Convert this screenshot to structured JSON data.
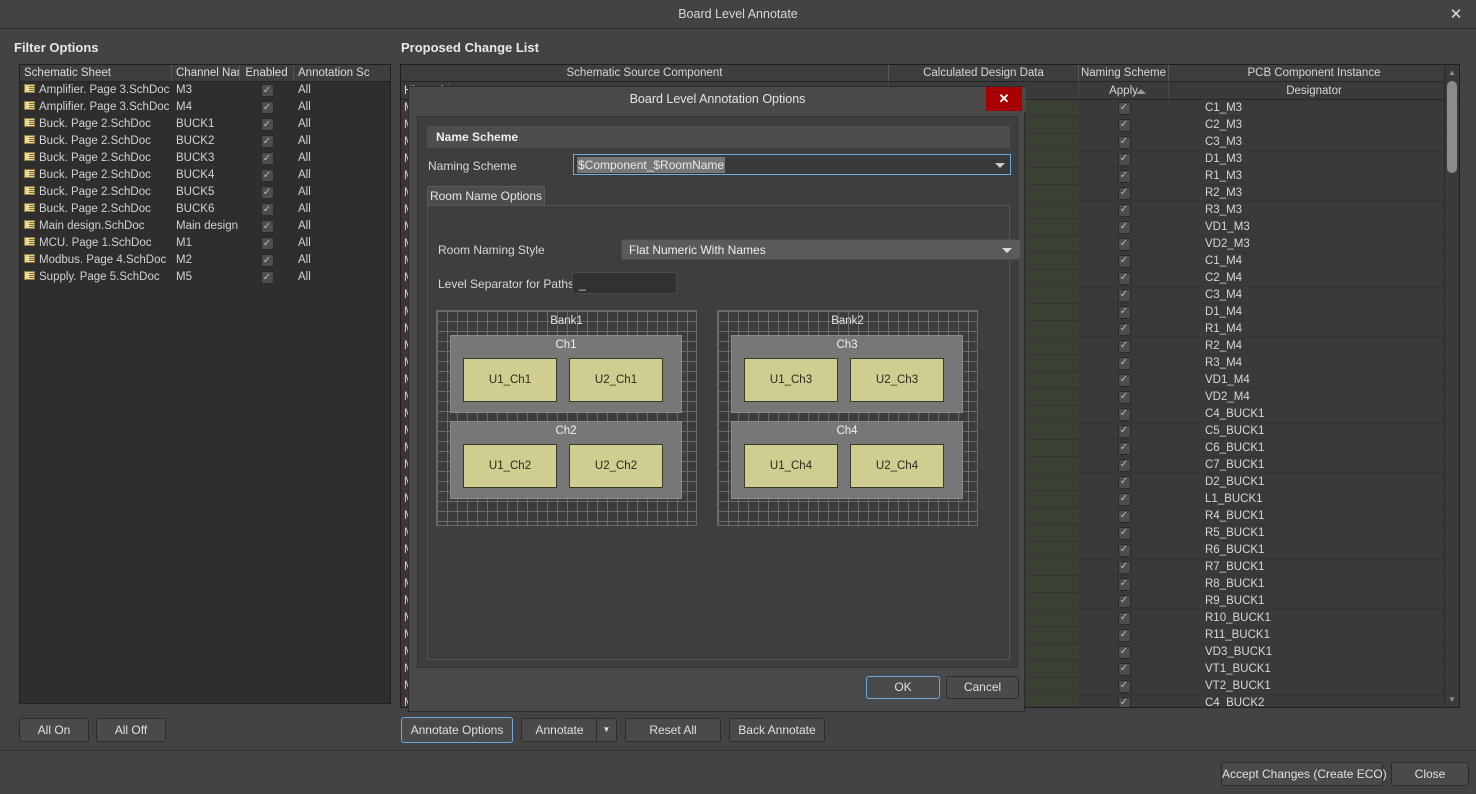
{
  "window": {
    "title": "Board Level Annotate",
    "close_icon": "close-icon"
  },
  "filter": {
    "label": "Filter Options",
    "columns": [
      "Schematic Sheet",
      "Channel Name",
      "Enabled",
      "Annotation Sc"
    ],
    "rows": [
      {
        "sheet": "Amplifier. Page 3.SchDoc",
        "channel": "M3",
        "enabled": true,
        "scope": "All"
      },
      {
        "sheet": "Amplifier. Page 3.SchDoc",
        "channel": "M4",
        "enabled": true,
        "scope": "All"
      },
      {
        "sheet": "Buck. Page 2.SchDoc",
        "channel": "BUCK1",
        "enabled": true,
        "scope": "All"
      },
      {
        "sheet": "Buck. Page 2.SchDoc",
        "channel": "BUCK2",
        "enabled": true,
        "scope": "All"
      },
      {
        "sheet": "Buck. Page 2.SchDoc",
        "channel": "BUCK3",
        "enabled": true,
        "scope": "All"
      },
      {
        "sheet": "Buck. Page 2.SchDoc",
        "channel": "BUCK4",
        "enabled": true,
        "scope": "All"
      },
      {
        "sheet": "Buck. Page 2.SchDoc",
        "channel": "BUCK5",
        "enabled": true,
        "scope": "All"
      },
      {
        "sheet": "Buck. Page 2.SchDoc",
        "channel": "BUCK6",
        "enabled": true,
        "scope": "All"
      },
      {
        "sheet": "Main design.SchDoc",
        "channel": "Main design",
        "enabled": true,
        "scope": "All"
      },
      {
        "sheet": "MCU. Page 1.SchDoc",
        "channel": "M1",
        "enabled": true,
        "scope": "All"
      },
      {
        "sheet": "Modbus. Page 4.SchDoc",
        "channel": "M2",
        "enabled": true,
        "scope": "All"
      },
      {
        "sheet": "Supply. Page 5.SchDoc",
        "channel": "M5",
        "enabled": true,
        "scope": "All"
      }
    ],
    "all_on_label": "All On",
    "all_off_label": "All Off"
  },
  "change_list": {
    "label": "Proposed Change List",
    "group_headers": [
      "Schematic Source Component",
      "Calculated Design Data",
      "Naming Scheme",
      "PCB Component Instance"
    ],
    "col_headers": {
      "hierarchy": "Hierarch",
      "apply": "Apply",
      "designator": "Designator"
    },
    "hierarchy_cell": "Main de",
    "rows": [
      {
        "designator": "C1_M3",
        "apply": true
      },
      {
        "designator": "C2_M3",
        "apply": true
      },
      {
        "designator": "C3_M3",
        "apply": true
      },
      {
        "designator": "D1_M3",
        "apply": true
      },
      {
        "designator": "R1_M3",
        "apply": true
      },
      {
        "designator": "R2_M3",
        "apply": true
      },
      {
        "designator": "R3_M3",
        "apply": true
      },
      {
        "designator": "VD1_M3",
        "apply": true
      },
      {
        "designator": "VD2_M3",
        "apply": true
      },
      {
        "designator": "C1_M4",
        "apply": true
      },
      {
        "designator": "C2_M4",
        "apply": true
      },
      {
        "designator": "C3_M4",
        "apply": true
      },
      {
        "designator": "D1_M4",
        "apply": true
      },
      {
        "designator": "R1_M4",
        "apply": true
      },
      {
        "designator": "R2_M4",
        "apply": true
      },
      {
        "designator": "R3_M4",
        "apply": true
      },
      {
        "designator": "VD1_M4",
        "apply": true
      },
      {
        "designator": "VD2_M4",
        "apply": true
      },
      {
        "designator": "C4_BUCK1",
        "apply": true
      },
      {
        "designator": "C5_BUCK1",
        "apply": true
      },
      {
        "designator": "C6_BUCK1",
        "apply": true
      },
      {
        "designator": "C7_BUCK1",
        "apply": true
      },
      {
        "designator": "D2_BUCK1",
        "apply": true
      },
      {
        "designator": "L1_BUCK1",
        "apply": true
      },
      {
        "designator": "R4_BUCK1",
        "apply": true
      },
      {
        "designator": "R5_BUCK1",
        "apply": true
      },
      {
        "designator": "R6_BUCK1",
        "apply": true
      },
      {
        "designator": "R7_BUCK1",
        "apply": true
      },
      {
        "designator": "R8_BUCK1",
        "apply": true
      },
      {
        "designator": "R9_BUCK1",
        "apply": true
      },
      {
        "designator": "R10_BUCK1",
        "apply": true
      },
      {
        "designator": "R11_BUCK1",
        "apply": true
      },
      {
        "designator": "VD3_BUCK1",
        "apply": true
      },
      {
        "designator": "VT1_BUCK1",
        "apply": true
      },
      {
        "designator": "VT2_BUCK1",
        "apply": true
      },
      {
        "designator": "C4_BUCK2",
        "apply": true
      }
    ],
    "scroll": {
      "up_icon": "chevron-up-icon",
      "down_icon": "chevron-down-icon"
    }
  },
  "toolbar": {
    "annotate_options_label": "Annotate Options",
    "annotate_label": "Annotate",
    "annotate_dropdown_icon": "chevron-down-icon",
    "reset_all_label": "Reset All",
    "back_annotate_label": "Back Annotate"
  },
  "footer": {
    "accept_label": "Accept Changes (Create ECO)",
    "close_label": "Close"
  },
  "dialog": {
    "title": "Board Level Annotation Options",
    "close_label": "✕",
    "name_scheme": {
      "section_title": "Name Scheme",
      "field_label": "Naming Scheme",
      "value": "$Component_$RoomName",
      "caret_icon": "chevron-down-icon"
    },
    "room_name_options": {
      "tab_label": "Room Name Options",
      "style_label": "Room Naming Style",
      "style_value": "Flat Numeric With Names",
      "style_caret_icon": "chevron-down-icon",
      "separator_label": "Level Separator for Paths",
      "separator_value": "_"
    },
    "preview": {
      "banks": [
        {
          "name": "Bank1",
          "channels": [
            {
              "name": "Ch1",
              "units": [
                "U1_Ch1",
                "U2_Ch1"
              ]
            },
            {
              "name": "Ch2",
              "units": [
                "U1_Ch2",
                "U2_Ch2"
              ]
            }
          ]
        },
        {
          "name": "Bank2",
          "channels": [
            {
              "name": "Ch3",
              "units": [
                "U1_Ch3",
                "U2_Ch3"
              ]
            },
            {
              "name": "Ch4",
              "units": [
                "U1_Ch4",
                "U2_Ch4"
              ]
            }
          ]
        }
      ]
    },
    "ok_label": "OK",
    "cancel_label": "Cancel"
  },
  "colors": {
    "accent_focus": "#6fa8dc",
    "close_red": "#a80000",
    "unit_fill": "#cfcd8f",
    "green_column": "#3a4036",
    "hierarchy_column": "#423434"
  }
}
